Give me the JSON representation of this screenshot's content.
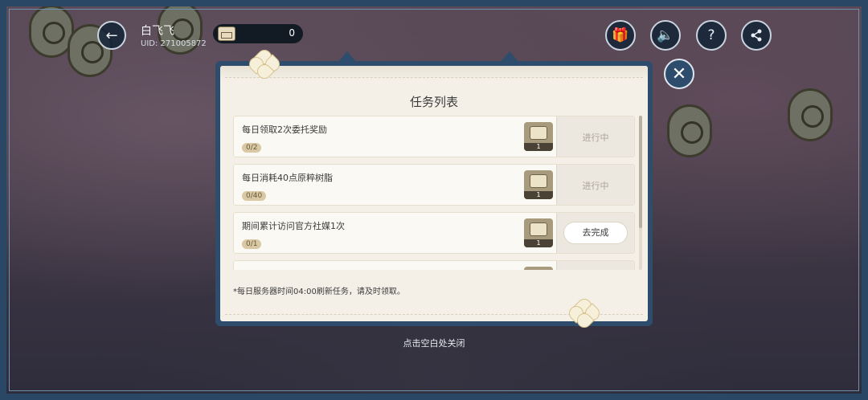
{
  "user": {
    "name": "白飞飞",
    "uid": "UID: 271005872"
  },
  "currency": {
    "value": "0",
    "icon": "chest-icon"
  },
  "top_icons": [
    "gift-icon",
    "sound-icon",
    "help-icon",
    "share-icon"
  ],
  "modal": {
    "title": "任务列表",
    "tasks": [
      {
        "name": "每日领取2次委托奖励",
        "progress": "0/2",
        "reward_count": "1",
        "status": "进行中"
      },
      {
        "name": "每日消耗40点原粹树脂",
        "progress": "0/40",
        "reward_count": "1",
        "status": "进行中"
      },
      {
        "name": "期间累计访问官方社媒1次",
        "progress": "0/1",
        "reward_count": "1",
        "button": "去完成"
      }
    ],
    "note": "*每日服务器时间04:00刷新任务，请及时领取。"
  },
  "dismiss_hint": "点击空白处关闭",
  "colors": {
    "panel_bg": "#f4f0e7",
    "frame": "#2e4d6d",
    "progress_badge": "#d9c8a3"
  }
}
